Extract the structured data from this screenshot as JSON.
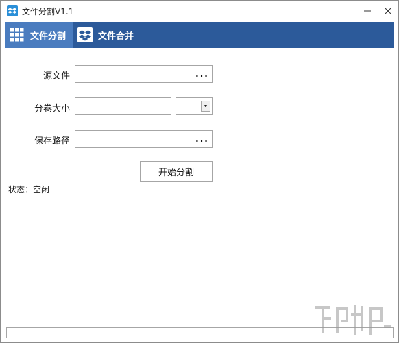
{
  "window": {
    "title": "文件分割V1.1",
    "icons": {
      "app": "dropbox-icon",
      "minimize": "minimize-icon",
      "close": "close-icon"
    }
  },
  "nav": {
    "tabs": [
      {
        "label": "文件分割",
        "icon": "grid-icon",
        "active": true
      },
      {
        "label": "文件合并",
        "icon": "dropbox-icon",
        "active": false
      }
    ]
  },
  "form": {
    "source_label": "源文件",
    "source_value": "",
    "size_label": "分卷大小",
    "size_value": "",
    "size_unit_value": "",
    "save_label": "保存路径",
    "save_value": "",
    "browse_label": "...",
    "start_label": "开始分割"
  },
  "status": {
    "text": "状态：空闲"
  },
  "progress": {
    "fraction": 0
  },
  "colors": {
    "navbar": "#2c5a9a",
    "active_tab": "#4a7cbf",
    "progress": "#06b025"
  }
}
